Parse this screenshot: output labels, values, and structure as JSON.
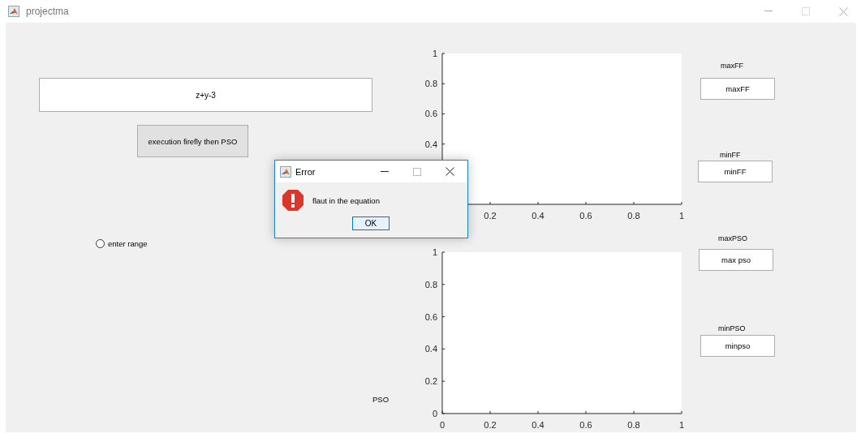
{
  "window": {
    "title": "projectma"
  },
  "left_panel": {
    "equation_field": {
      "value": "z+y-3"
    },
    "run_button": {
      "label": "execution firefly then PSO"
    },
    "range_radio": {
      "label": "enter range",
      "selected": false
    },
    "pso_label": "PSO"
  },
  "charts": [
    {
      "chart_data": {
        "type": "line",
        "xlim": [
          0,
          1
        ],
        "ylim": [
          0,
          1
        ],
        "xticks": [
          0.2,
          0.4,
          0.6,
          0.8,
          1
        ],
        "yticks": [
          0.4,
          0.6,
          0.8,
          1
        ]
      }
    },
    {
      "chart_data": {
        "type": "line",
        "xlim": [
          0,
          1
        ],
        "ylim": [
          0,
          1
        ],
        "xticks": [
          0,
          0.2,
          0.4,
          0.6,
          0.8,
          1
        ],
        "yticks": [
          0,
          0.2,
          0.4,
          0.6,
          0.8,
          1
        ]
      }
    }
  ],
  "results": [
    {
      "label": "maxFF",
      "value": "maxFF"
    },
    {
      "label": "minFF",
      "value": "minFF"
    },
    {
      "label": "maxPSO",
      "value": "max pso"
    },
    {
      "label": "minPSO",
      "value": "minpso"
    }
  ],
  "dialog": {
    "title": "Error",
    "message": "flaut in the equation",
    "button": "OK"
  }
}
